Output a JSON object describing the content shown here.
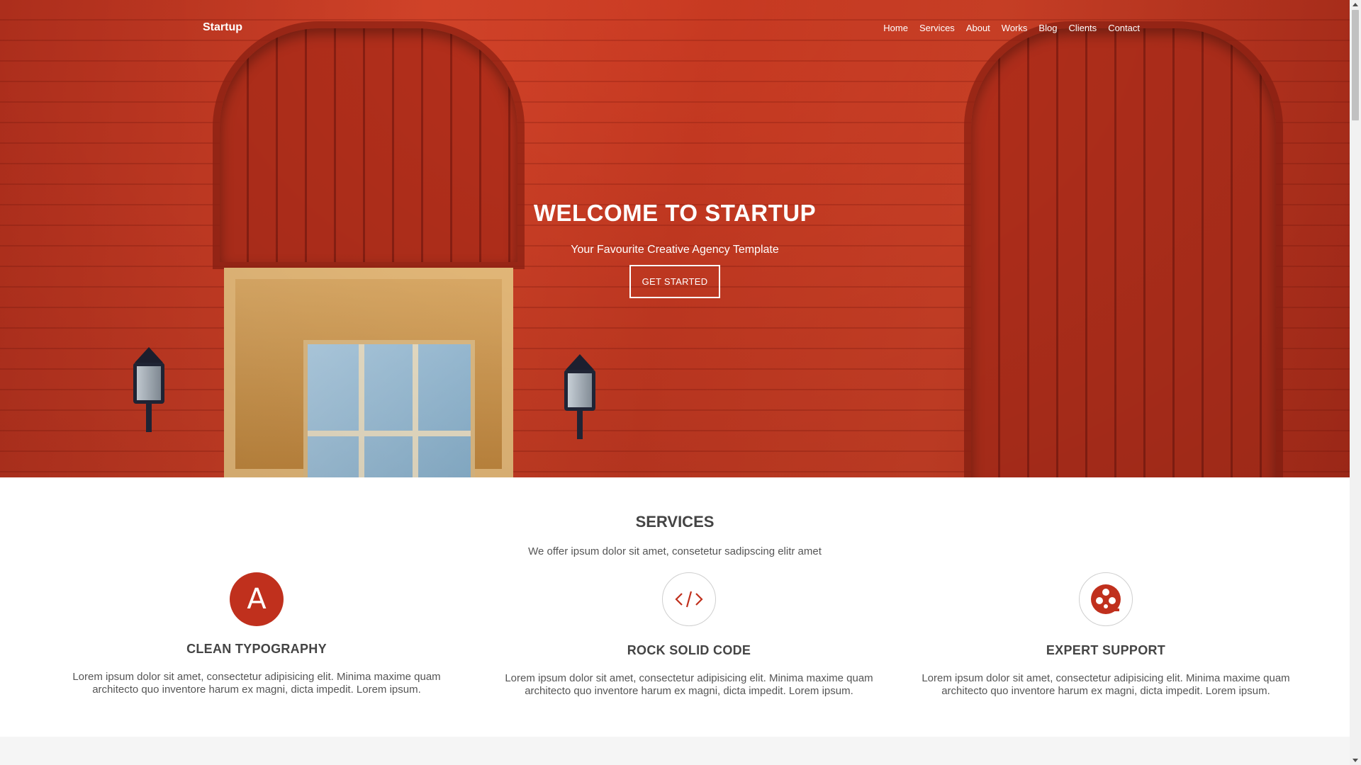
{
  "nav": {
    "brand": "Startup",
    "links": [
      "Home",
      "Services",
      "About",
      "Works",
      "Blog",
      "Clients",
      "Contact"
    ]
  },
  "hero": {
    "title": "WELCOME TO STARTUP",
    "subtitle": "Your Favourite Creative Agency Template",
    "button": "GET STARTED"
  },
  "services": {
    "title": "SERVICES",
    "subtitle": "We offer ipsum dolor sit amet, consetetur sadipscing elitr amet",
    "items": [
      {
        "icon": "letter-a-icon",
        "icon_text": "A",
        "name": "CLEAN TYPOGRAPHY",
        "desc": "Lorem ipsum dolor sit amet, consectetur adipisicing elit. Minima maxime quam architecto quo inventore harum ex magni, dicta impedit. Lorem ipsum."
      },
      {
        "icon": "code-icon",
        "name": "ROCK SOLID CODE",
        "desc": "Lorem ipsum dolor sit amet, consectetur adipisicing elit. Minima maxime quam architecto quo inventore harum ex magni, dicta impedit. Lorem ipsum."
      },
      {
        "icon": "support-reel-icon",
        "name": "EXPERT SUPPORT",
        "desc": "Lorem ipsum dolor sit amet, consectetur adipisicing elit. Minima maxime quam architecto quo inventore harum ex magni, dicta impedit. Lorem ipsum."
      }
    ]
  },
  "colors": {
    "accent": "#c0301d",
    "text_dark": "#444444",
    "text_body": "#555555"
  }
}
